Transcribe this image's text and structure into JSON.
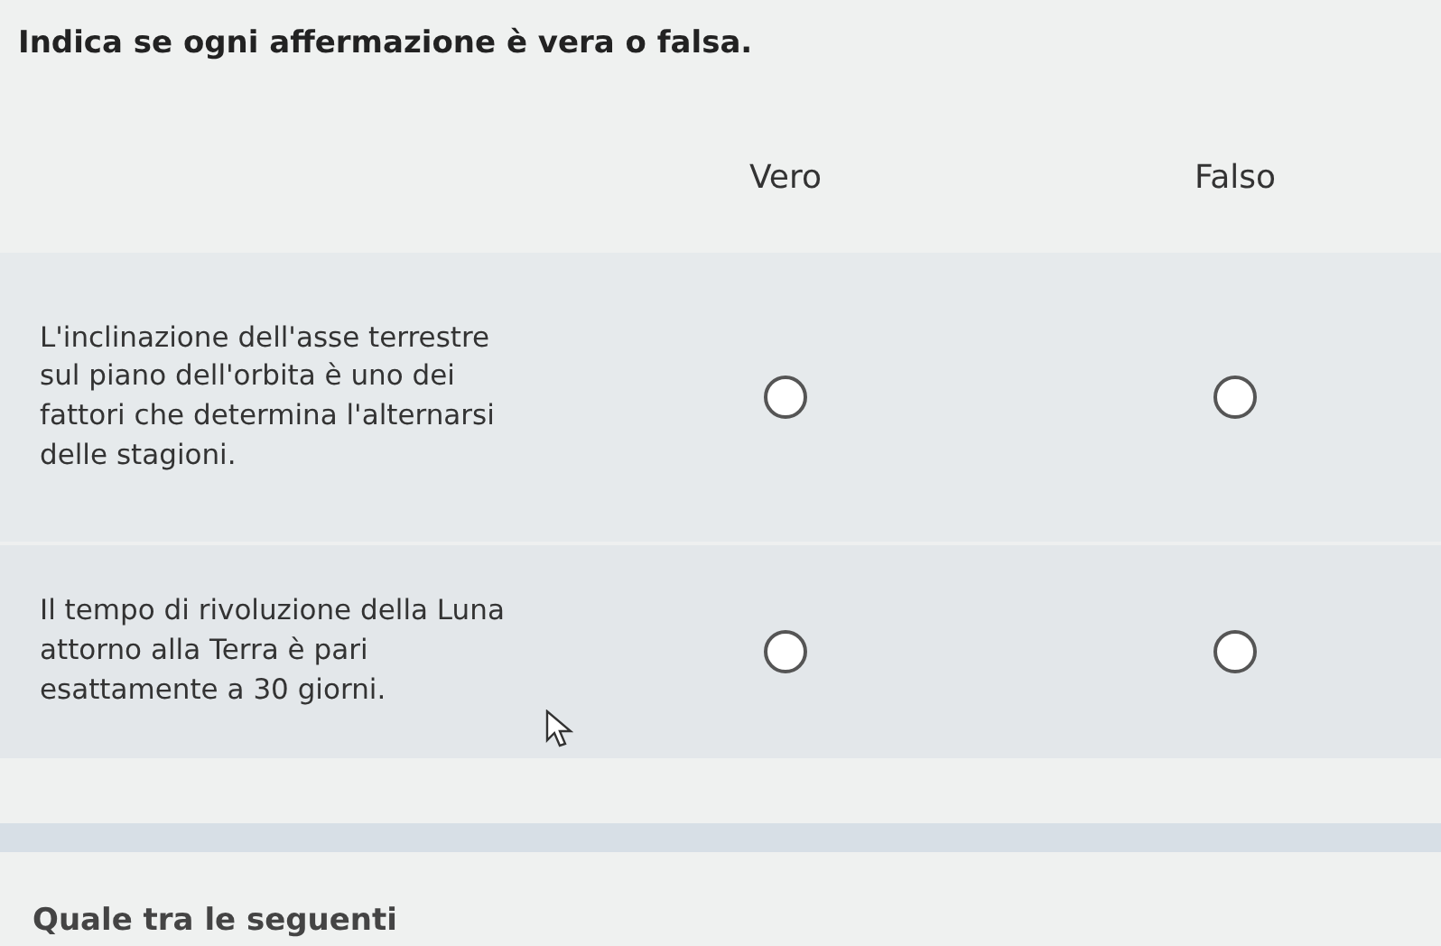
{
  "instruction": "Indica se ogni affermazione è vera o falsa.",
  "columns": [
    "Vero",
    "Falso"
  ],
  "rows": [
    {
      "statement": "L'inclinazione dell'asse terrestre sul piano dell'orbita è uno dei fattori che determina l'alternarsi delle stagioni.",
      "options": [
        {
          "selected": false
        },
        {
          "selected": false
        }
      ]
    },
    {
      "statement": "Il tempo di rivoluzione della Luna attorno alla Terra è pari esattamente a 30 giorni.",
      "options": [
        {
          "selected": false
        },
        {
          "selected": false
        }
      ]
    }
  ],
  "next_question": "Quale tra le seguenti"
}
